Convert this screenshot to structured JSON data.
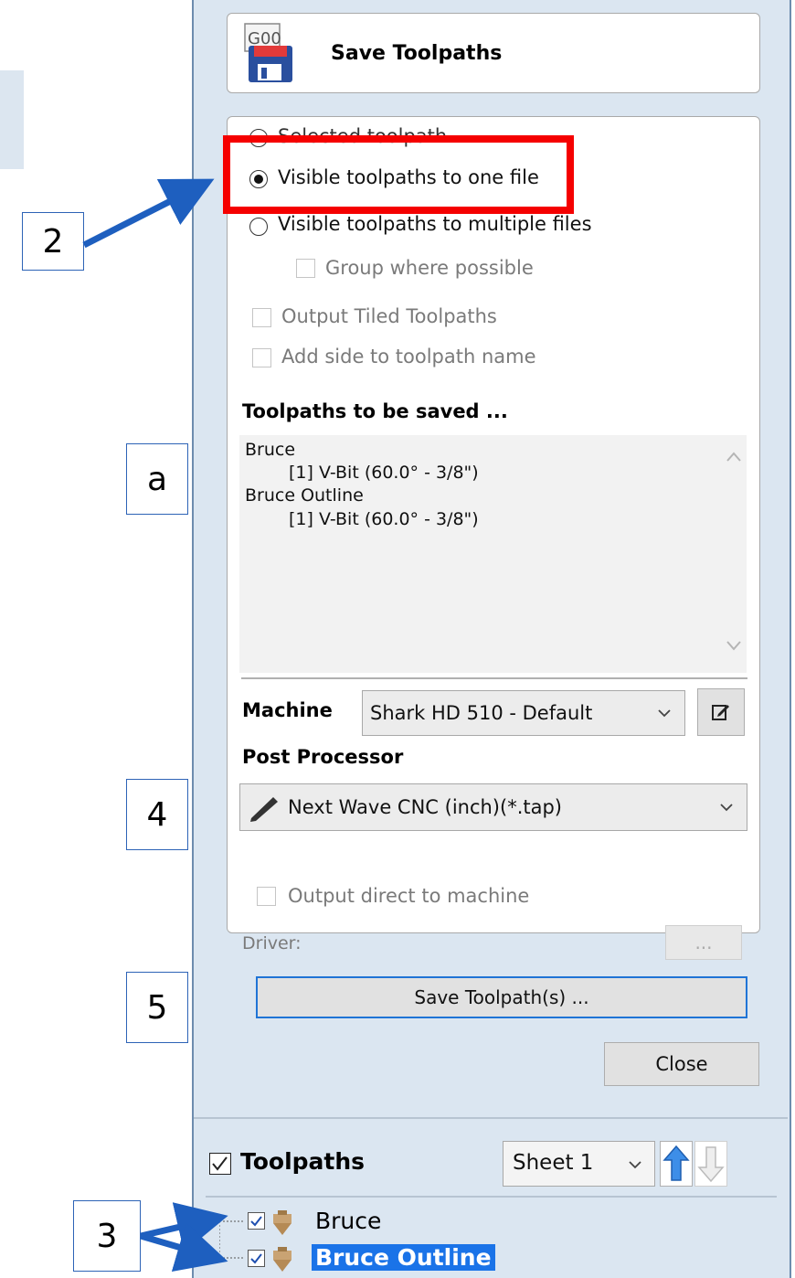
{
  "dialog": {
    "title": "Save Toolpaths",
    "icon_name": "g00-save-icon",
    "icon_text": "G00",
    "options": {
      "selected_toolpath": "Selected toolpath",
      "visible_one_file": "Visible toolpaths to one file",
      "visible_multiple_files": "Visible toolpaths to multiple files",
      "group_where_possible": "Group where possible",
      "output_tiled": "Output Tiled Toolpaths",
      "add_side": "Add side to toolpath name"
    },
    "selected_option": "visible_one_file",
    "toolpaths_heading": "Toolpaths to be saved ...",
    "toolpaths_list": [
      {
        "name": "Bruce",
        "tool": "[1] V-Bit (60.0° - 3/8\")"
      },
      {
        "name": "Bruce Outline",
        "tool": "[1] V-Bit (60.0° - 3/8\")"
      }
    ],
    "machine_label": "Machine",
    "machine_value": "Shark HD 510 - Default",
    "post_processor_label": "Post Processor",
    "post_processor_value": "Next Wave CNC (inch)(*.tap)",
    "output_direct": "Output direct to machine",
    "driver_label": "Driver:",
    "driver_button": "...",
    "save_button": "Save Toolpath(s) ...",
    "close_button": "Close"
  },
  "toolpaths_panel": {
    "header": "Toolpaths",
    "sheet_value": "Sheet 1",
    "items": [
      {
        "name": "Bruce",
        "checked": true,
        "selected": false
      },
      {
        "name": "Bruce Outline",
        "checked": true,
        "selected": true
      }
    ]
  },
  "callouts": {
    "c2": "2",
    "ca": "a",
    "c4": "4",
    "c5": "5",
    "c3": "3"
  },
  "colors": {
    "highlight_red": "#f50000",
    "callout_blue": "#1e5fbf",
    "selection_blue": "#1a73e8",
    "panel_bg": "#dbe6f1"
  }
}
